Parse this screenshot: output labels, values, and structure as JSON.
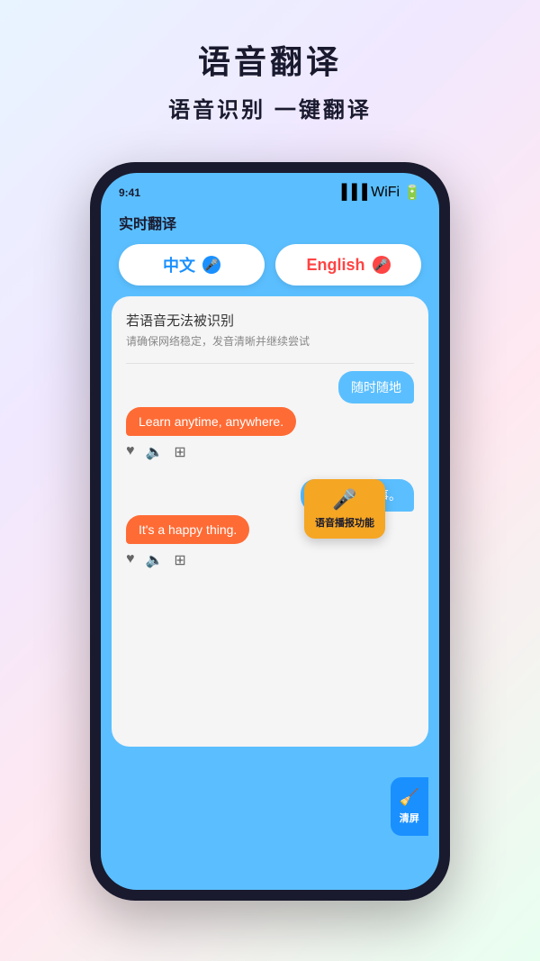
{
  "header": {
    "main_title": "语音翻译",
    "sub_title": "语音识别 一键翻译"
  },
  "app": {
    "title": "实时翻译",
    "lang_cn": "中文",
    "lang_en": "English",
    "error_title": "若语音无法被识别",
    "error_sub": "请确保网络稳定，发音清晰并继续尝试",
    "bubble1_right": "随时随地",
    "bubble1_left": "Learn anytime, anywhere.",
    "bubble2_right": "一件快乐的事。",
    "bubble2_left": "It's a happy thing.",
    "tooltip_text": "语音播报功能",
    "clear_text": "清屏"
  },
  "colors": {
    "blue": "#1a90ff",
    "red": "#ff4444",
    "orange": "#ff6b35",
    "tooltip_bg": "#f5a623"
  }
}
